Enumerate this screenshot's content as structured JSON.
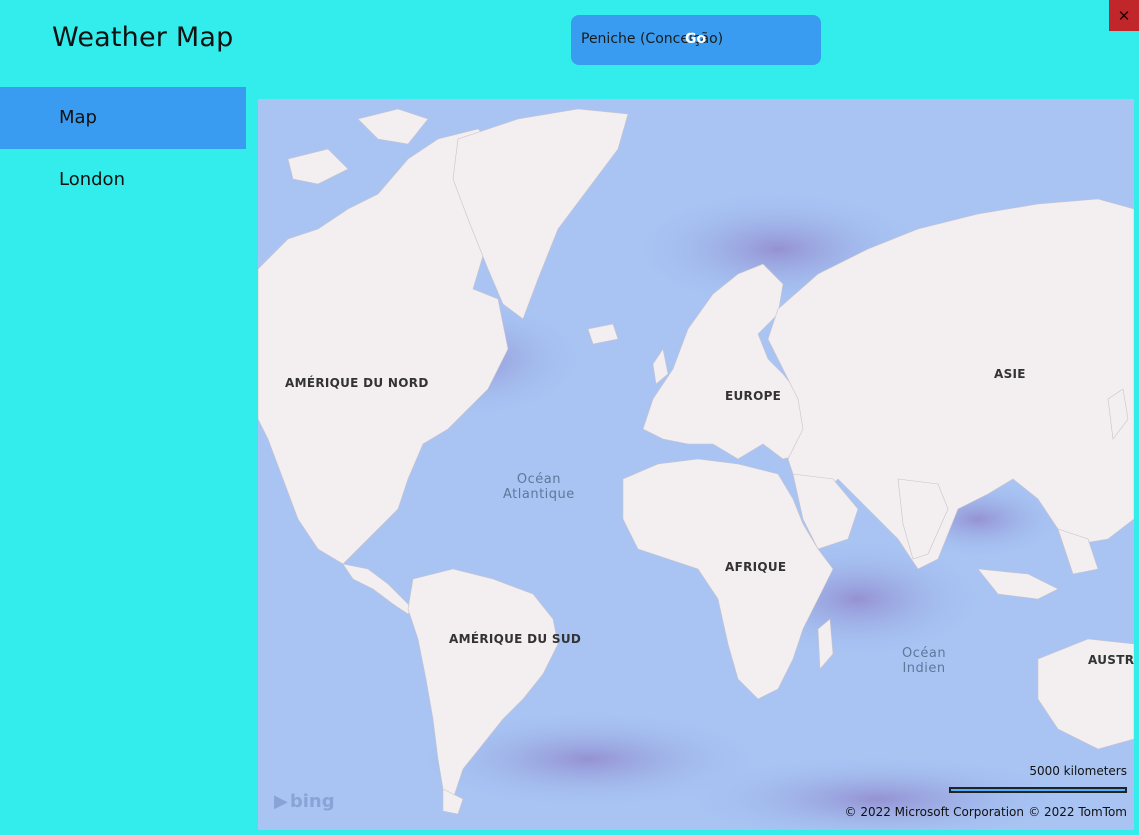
{
  "app": {
    "title": "Weather Map"
  },
  "search": {
    "value": "Peniche (Conceição)",
    "go_label": "Go"
  },
  "window": {
    "close_glyph": "✕",
    "close_color": "#c0262a"
  },
  "sidebar": {
    "items": [
      {
        "label": "Map",
        "selected": true
      },
      {
        "label": "London",
        "selected": false
      }
    ]
  },
  "map": {
    "continents": {
      "north_america": "AMÉRIQUE DU NORD",
      "europe": "EUROPE",
      "asia": "ASIE",
      "africa": "AFRIQUE",
      "south_america": "AMÉRIQUE DU SUD",
      "australia": "AUSTRA"
    },
    "oceans": {
      "atlantic_line1": "Océan",
      "atlantic_line2": "Atlantique",
      "indian_line1": "Océan",
      "indian_line2": "Indien"
    },
    "scale_label": "5000 kilometers",
    "copyright_microsoft": "© 2022 Microsoft Corporation",
    "copyright_tomtom": "© 2022 TomTom",
    "provider_logo": "bing"
  },
  "colors": {
    "background": "#33ecec",
    "accent": "#3a9cf0",
    "ocean": "#9cc3f5",
    "land": "#f2eeee"
  }
}
